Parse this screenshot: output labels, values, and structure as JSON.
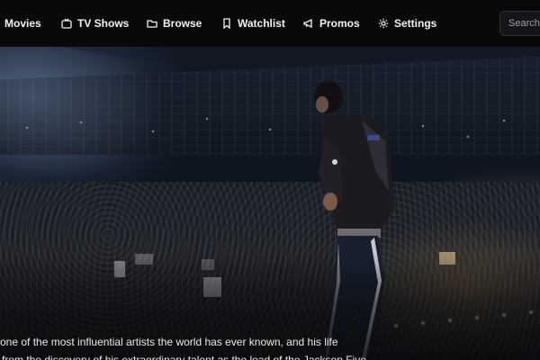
{
  "nav": {
    "items": [
      {
        "label": "Movies",
        "icon": "film-icon"
      },
      {
        "label": "TV Shows",
        "icon": "tv-icon"
      },
      {
        "label": "Browse",
        "icon": "folder-icon"
      },
      {
        "label": "Watchlist",
        "icon": "bookmark-icon"
      },
      {
        "label": "Promos",
        "icon": "megaphone-icon"
      },
      {
        "label": "Settings",
        "icon": "gear-icon"
      }
    ],
    "search_placeholder": "Search"
  },
  "hero": {
    "image": "concert-performer-stadium",
    "description_lines": [
      "one of the most influential artists the world has ever known, and his life",
      "from the discovery of his extraordinary talent as the lead of the Jackson Five"
    ]
  },
  "colors": {
    "nav_background": "#090909",
    "text": "#f2f2f2",
    "search_border": "#2e3036"
  }
}
